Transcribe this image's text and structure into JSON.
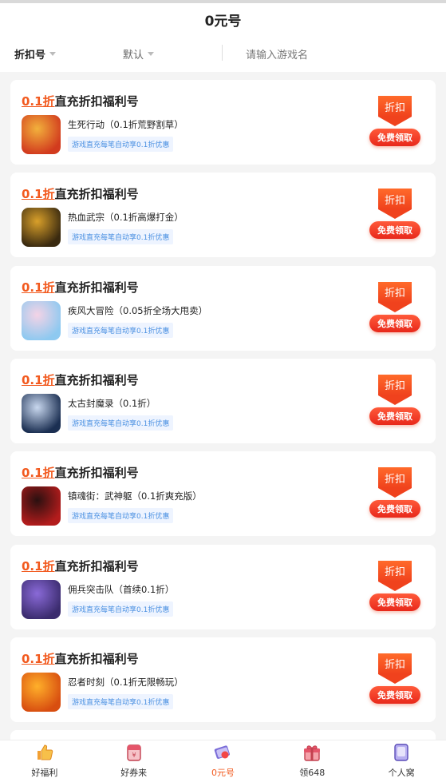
{
  "header": {
    "title": "0元号"
  },
  "filters": {
    "sort_label": "折扣号",
    "default_label": "默认",
    "search_placeholder": "请输入游戏名"
  },
  "cards": [
    {
      "discount": "0.1折",
      "title_rest": "直充折扣福利号",
      "game": "生死行动（0.1折荒野割草）",
      "tag": "游戏直充每笔自动享0.1折优惠",
      "ribbon": "折扣",
      "button": "免费领取",
      "icon": "hero-cartoon-icon",
      "colors": [
        "#d23b1e",
        "#f2b13c"
      ]
    },
    {
      "discount": "0.1折",
      "title_rest": "直充折扣福利号",
      "game": "热血武宗（0.1折高爆打金）",
      "tag": "游戏直充每笔自动享0.1折优惠",
      "ribbon": "折扣",
      "button": "免费领取",
      "icon": "golden-warrior-icon",
      "colors": [
        "#3a2a10",
        "#d9a02a"
      ]
    },
    {
      "discount": "0.1折",
      "title_rest": "直充折扣福利号",
      "game": "疾风大冒险（0.05折全场大甩卖）",
      "tag": "游戏直充每笔自动享0.1折优惠",
      "ribbon": "折扣",
      "button": "免费领取",
      "icon": "anime-girl-icon",
      "colors": [
        "#8ec9f0",
        "#f4d3e6"
      ]
    },
    {
      "discount": "0.1折",
      "title_rest": "直充折扣福利号",
      "game": "太古封魔录（0.1折）",
      "tag": "游戏直充每笔自动享0.1折优惠",
      "ribbon": "折扣",
      "button": "免费领取",
      "icon": "dark-swordsman-icon",
      "colors": [
        "#1b2f52",
        "#c9d8ef"
      ]
    },
    {
      "discount": "0.1折",
      "title_rest": "直充折扣福利号",
      "game": "镇魂街：武神躯（0.1折爽充版）",
      "tag": "游戏直充每笔自动享0.1折优惠",
      "ribbon": "折扣",
      "button": "免费领取",
      "icon": "red-hair-hero-icon",
      "colors": [
        "#b31c1c",
        "#2a1010"
      ]
    },
    {
      "discount": "0.1折",
      "title_rest": "直充折扣福利号",
      "game": "佣兵突击队（首续0.1折）",
      "tag": "游戏直充每笔自动享0.1折优惠",
      "ribbon": "折扣",
      "button": "免费领取",
      "icon": "raccoon-soldier-icon",
      "colors": [
        "#3b2c6e",
        "#8a6ad8"
      ]
    },
    {
      "discount": "0.1折",
      "title_rest": "直充折扣福利号",
      "game": "忍者时刻（0.1折无限畅玩）",
      "tag": "游戏直充每笔自动享0.1折优惠",
      "ribbon": "折扣",
      "button": "免费领取",
      "icon": "fire-ninja-icon",
      "colors": [
        "#d84e10",
        "#ffb02a"
      ]
    }
  ],
  "tabbar": [
    {
      "label": "好福利",
      "icon": "thumbs-up-icon"
    },
    {
      "label": "好券来",
      "icon": "coupon-bag-icon"
    },
    {
      "label": "0元号",
      "icon": "zero-account-icon"
    },
    {
      "label": "领648",
      "icon": "gift-box-icon"
    },
    {
      "label": "个人窝",
      "icon": "profile-card-icon"
    }
  ],
  "accent_color": "#f25a1f"
}
